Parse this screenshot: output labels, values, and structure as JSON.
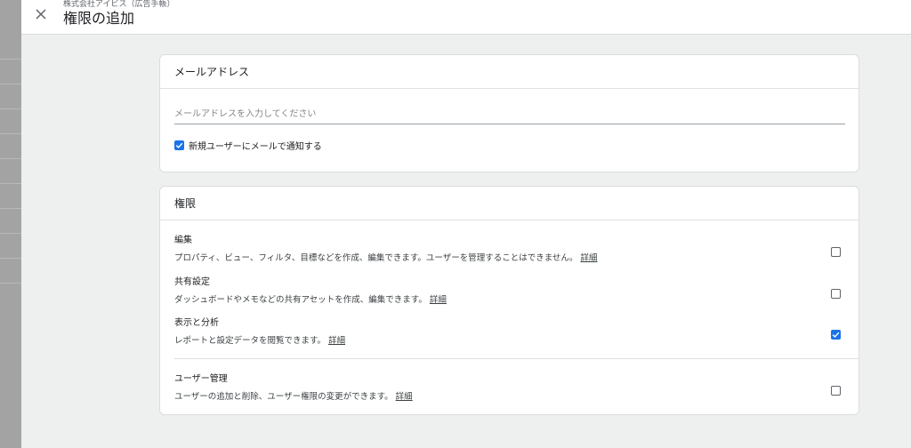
{
  "header": {
    "subtitle": "株式会社アイビス（広告手帳）",
    "title": "権限の追加"
  },
  "email_card": {
    "heading": "メールアドレス",
    "input_placeholder": "メールアドレスを入力してください",
    "input_value": "",
    "notify_label": "新規ユーザーにメールで通知する",
    "notify_checked": true
  },
  "permissions_card": {
    "heading": "権限",
    "items": [
      {
        "name": "編集",
        "desc": "プロパティ、ビュー、フィルタ、目標などを作成、編集できます。ユーザーを管理することはできません。",
        "link": "詳細",
        "checked": false
      },
      {
        "name": "共有設定",
        "desc": "ダッシュボードやメモなどの共有アセットを作成、編集できます。",
        "link": "詳細",
        "checked": false
      },
      {
        "name": "表示と分析",
        "desc": "レポートと設定データを閲覧できます。",
        "link": "詳細",
        "checked": true
      },
      {
        "name": "ユーザー管理",
        "desc": "ユーザーの追加と削除、ユーザー権限の変更ができます。",
        "link": "詳細",
        "checked": false
      }
    ]
  },
  "icons": {
    "close": "close-icon",
    "checkbox_checked": "check-icon"
  },
  "colors": {
    "accent": "#1a73e8",
    "panel_bg": "#eef0f0"
  }
}
